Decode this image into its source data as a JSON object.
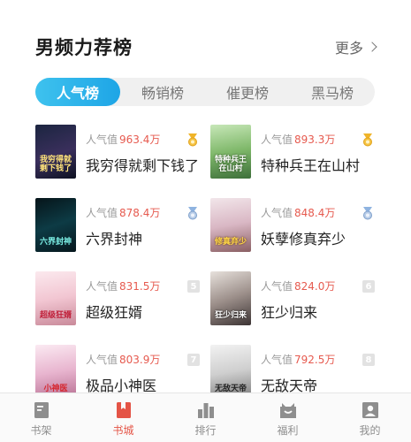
{
  "section": {
    "title": "男频力荐榜",
    "more_label": "更多"
  },
  "tabs": [
    {
      "label": "人气榜",
      "active": true
    },
    {
      "label": "畅销榜",
      "active": false
    },
    {
      "label": "催更榜",
      "active": false
    },
    {
      "label": "黑马榜",
      "active": false
    }
  ],
  "popularity_label": "人气值",
  "books": [
    {
      "rank": 1,
      "name": "我穷得就剩下钱了",
      "popularity": "963.4万",
      "badge": "gold-medal-icon",
      "cover_text": "我穷得就剩下钱了"
    },
    {
      "rank": 2,
      "name": "特种兵王在山村",
      "popularity": "893.3万",
      "badge": "gold-medal-icon",
      "cover_text": "特种兵王在山村"
    },
    {
      "rank": 3,
      "name": "六界封神",
      "popularity": "878.4万",
      "badge": "silver-medal-icon",
      "cover_text": "六界封神"
    },
    {
      "rank": 4,
      "name": "妖孽修真弃少",
      "popularity": "848.4万",
      "badge": "silver-medal-icon",
      "cover_text": "修真弃少"
    },
    {
      "rank": 5,
      "name": "超级狂婿",
      "popularity": "831.5万",
      "badge": "5",
      "cover_text": "超级狂婿"
    },
    {
      "rank": 6,
      "name": "狂少归来",
      "popularity": "824.0万",
      "badge": "6",
      "cover_text": "狂少归来"
    },
    {
      "rank": 7,
      "name": "极品小神医",
      "popularity": "803.9万",
      "badge": "7",
      "cover_text": "小神医"
    },
    {
      "rank": 8,
      "name": "无敌天帝",
      "popularity": "792.5万",
      "badge": "8",
      "cover_text": "无敌天帝"
    }
  ],
  "nav": [
    {
      "label": "书架",
      "icon": "bookshelf-icon",
      "active": false
    },
    {
      "label": "书城",
      "icon": "bookstore-icon",
      "active": true
    },
    {
      "label": "排行",
      "icon": "ranking-icon",
      "active": false
    },
    {
      "label": "福利",
      "icon": "gift-icon",
      "active": false
    },
    {
      "label": "我的",
      "icon": "profile-icon",
      "active": false
    }
  ],
  "colors": {
    "accent_blue": "#1ea5e6",
    "accent_red": "#e45446",
    "popularity_red": "#e65a4f"
  }
}
